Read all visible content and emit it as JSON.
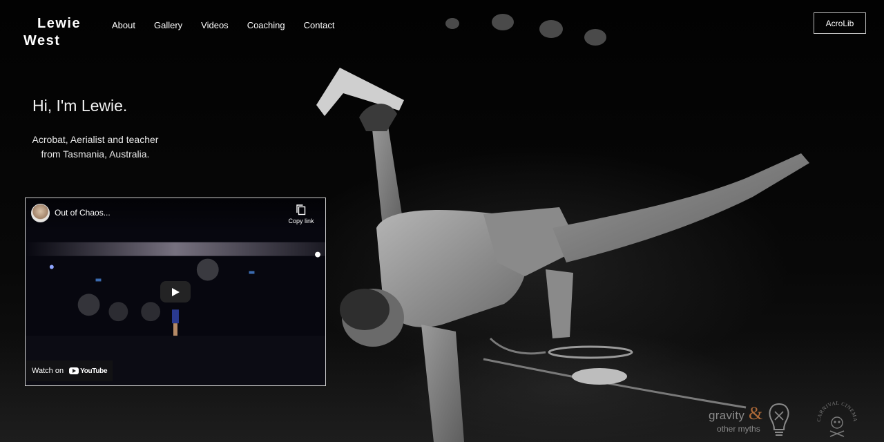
{
  "header": {
    "logo_line1": "Lewie",
    "logo_line2": "West",
    "nav": [
      "About",
      "Gallery",
      "Videos",
      "Coaching",
      "Contact"
    ],
    "cta_label": "AcroLib"
  },
  "hero": {
    "title": "Hi, I'm Lewie.",
    "subtitle": "Acrobat, Aerialist and teacher from Tasmania, Australia."
  },
  "video": {
    "title": "Out of Chaos...",
    "copy_link_label": "Copy link",
    "watch_on_label": "Watch on",
    "youtube_label": "YouTube"
  },
  "sponsors": {
    "gravity_word": "gravity",
    "gravity_amp": "&",
    "gravity_sub": "other myths",
    "carnival_label": "CARNIVAL CINEMA"
  },
  "icons": [
    "copy-icon",
    "play-icon",
    "youtube-logo-icon",
    "lightbulb-icon",
    "skull-icon"
  ],
  "colors": {
    "background": "#050505",
    "text": "#ffffff",
    "button_border": "#bdbdbd",
    "gravity_amp": "#b06a38"
  }
}
